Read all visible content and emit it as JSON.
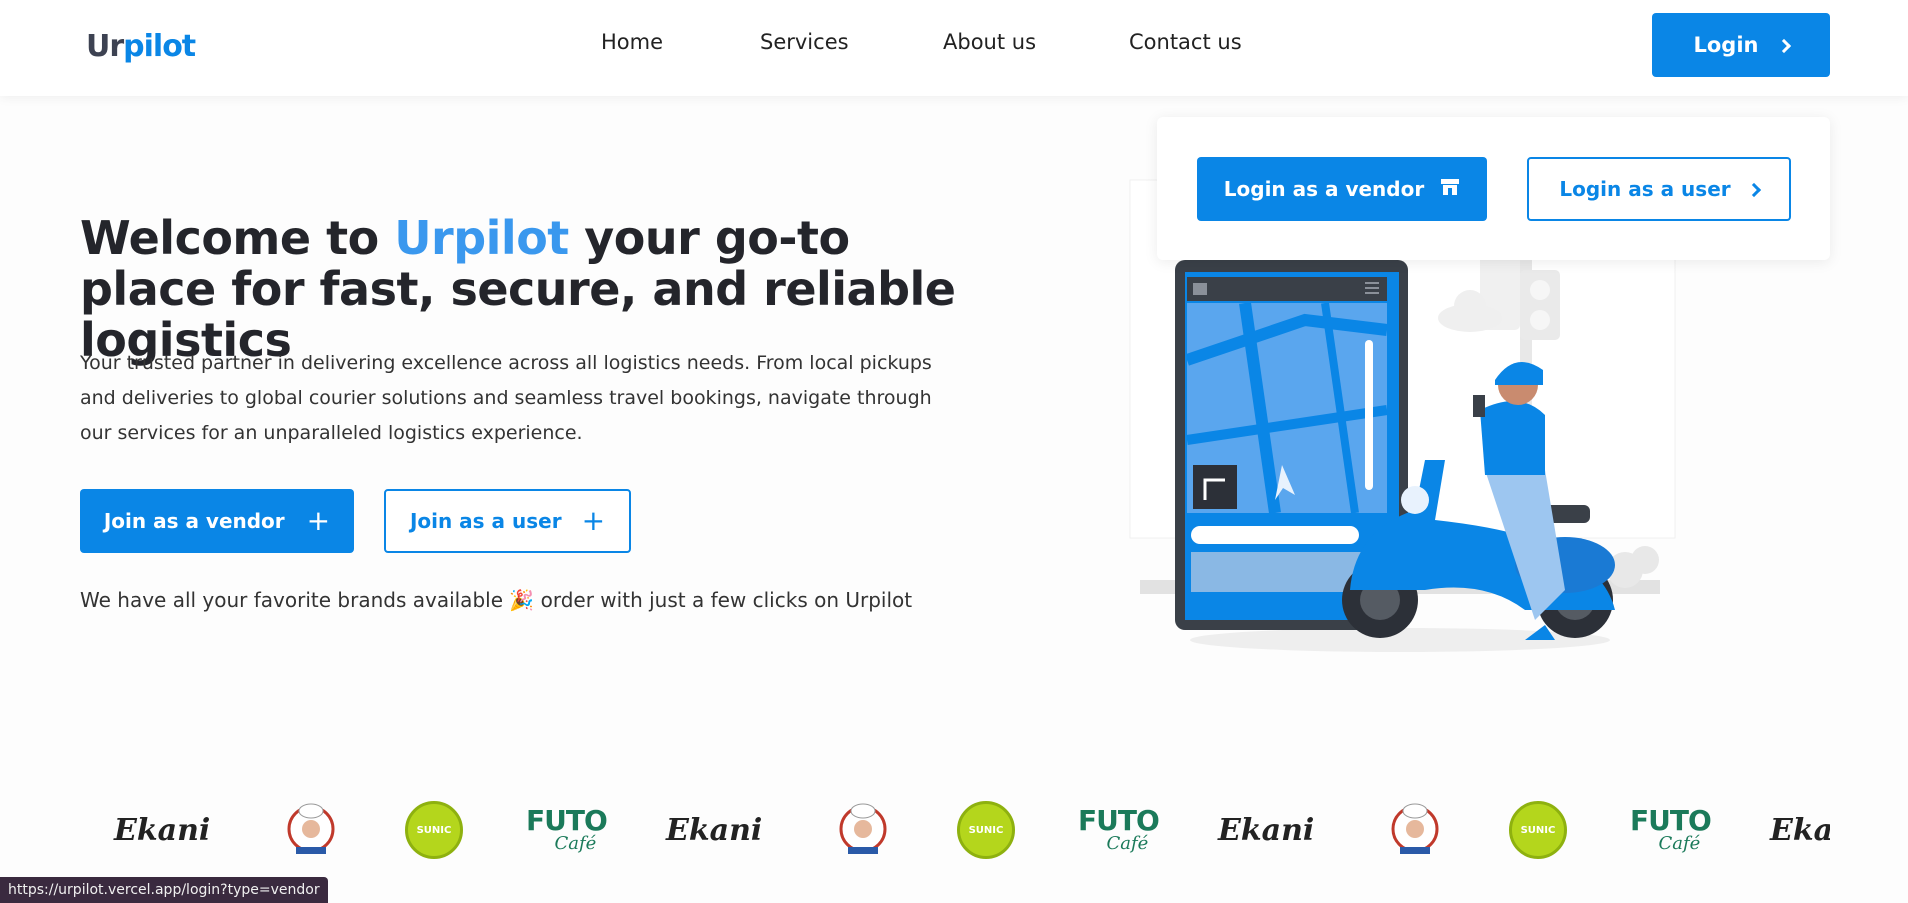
{
  "nav": {
    "logo_prefix": "Ur",
    "logo_suffix": "pilot",
    "links": [
      "Home",
      "Services",
      "About us",
      "Contact us"
    ],
    "login_label": "Login"
  },
  "login_panel": {
    "vendor_label": "Login as a vendor",
    "user_label": "Login as a user"
  },
  "hero": {
    "title_part1": "Welcome to ",
    "title_brand": "Urpilot",
    "title_part2": " your go-to place for fast, secure, and reliable logistics",
    "description": "Your trusted partner in delivering excellence across all logistics needs. From local pickups and deliveries to global courier solutions and seamless travel bookings, navigate through our services for an unparalleled logistics experience.",
    "join_vendor_label": "Join as a vendor",
    "join_user_label": "Join as a user",
    "brands_text_before": "We have all your favorite brands available ",
    "brands_emoji": "🎉",
    "brands_text_after": " order with just a few clicks on Urpilot"
  },
  "brands": {
    "ekani": "Ekani",
    "futo_line1": "FUTO",
    "futo_line2": "Café",
    "sunic": "SUNIC"
  },
  "status_bar": {
    "url": "https://urpilot.vercel.app/login?type=vendor"
  },
  "colors": {
    "primary": "#0a86e6",
    "accent_text": "#3a98ee",
    "heading": "#24252b"
  }
}
